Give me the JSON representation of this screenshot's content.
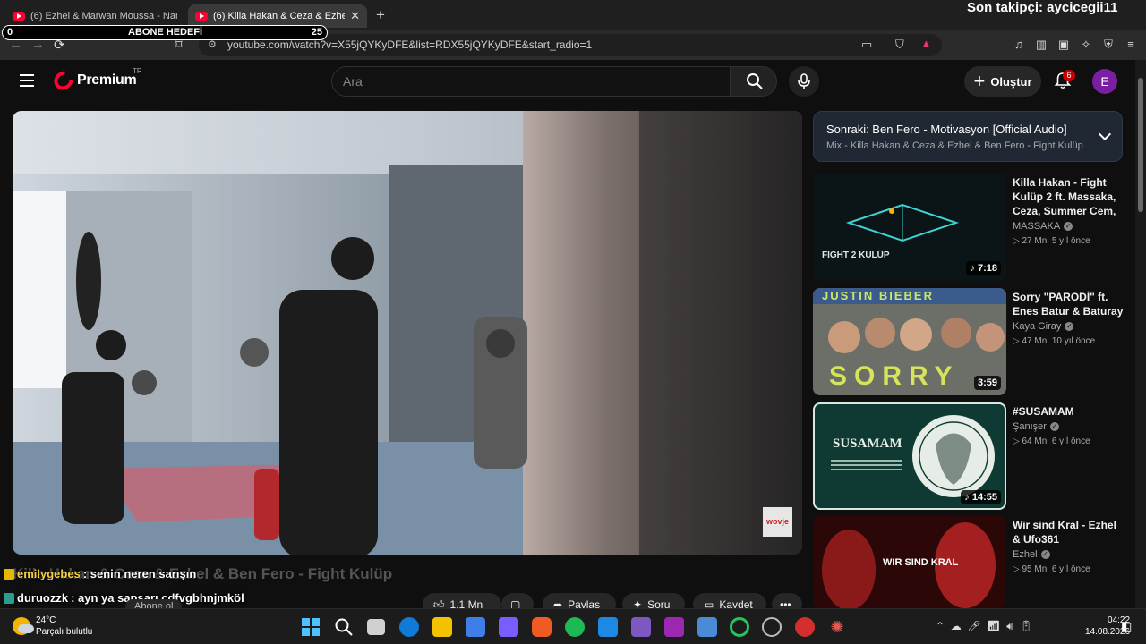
{
  "browser": {
    "tabs": [
      {
        "title": "(6) Ezhel & Marwan Moussa - Nane ¿",
        "active": false
      },
      {
        "title": "(6) Killa Hakan & Ceza & Ezhel &",
        "active": true
      }
    ],
    "new_tab": "+",
    "url": "youtube.com/watch?v=X55jQYKyDFE&list=RDX55jQYKyDFE&start_radio=1"
  },
  "stream_overlay": {
    "follower": "Son takipçi: aycicegii11",
    "goal_label": "ABONE HEDEFİ",
    "goal_start": "0",
    "goal_target": "25",
    "chat": [
      {
        "user": "emilygebes",
        "message": ": senin neren sarışın"
      },
      {
        "user": "duruozzk",
        "message": ": ayn ya sapsarı cdfvgbhnjmköl"
      }
    ]
  },
  "youtube": {
    "logo": "Premium",
    "region": "TR",
    "search_placeholder": "Ara",
    "create_label": "Oluştur",
    "notification_count": "6",
    "avatar_initial": "E",
    "video_title": "Killa Hakan & Ceza & Ezhel & Ben Fero - Fight Kulüp",
    "watermark": "wovje",
    "subscribe_label": "Abone ol",
    "actions": {
      "likes": "1,1 Mn",
      "share": "Paylaş",
      "ask": "Soru",
      "save": "Kaydet"
    },
    "up_next": {
      "title": "Sonraki: Ben Fero - Motivasyon [Official Audio]",
      "subtitle": "Mix - Killa Hakan & Ceza & Ezhel & Ben Fero - Fight Kulüp"
    },
    "recommendations": [
      {
        "title": "Killa Hakan - Fight Kulüp 2 ft. Massaka, Ceza, Summer Cem, ...",
        "channel": "MASSAKA",
        "views": "27 Mn",
        "age": "5 yıl önce",
        "duration": "7:18",
        "thumb_text": "FIGHT 2 KULÜP"
      },
      {
        "title": "Sorry \"PARODİ\" ft. Enes Batur & Baturay",
        "channel": "Kaya Giray",
        "views": "47 Mn",
        "age": "10 yıl önce",
        "duration": "3:59",
        "thumb_text": "SORRY",
        "thumb_text2": "JUSTIN BIEBER"
      },
      {
        "title": "#SUSAMAM",
        "channel": "Şanışer",
        "views": "64 Mn",
        "age": "6 yıl önce",
        "duration": "14:55",
        "thumb_text": "SUSAMAM"
      },
      {
        "title": "Wir sind Kral - Ezhel & Ufo361",
        "channel": "Ezhel",
        "views": "95 Mn",
        "age": "6 yıl önce",
        "duration": "",
        "thumb_text": "WIR SIND KRAL"
      }
    ]
  },
  "taskbar": {
    "temperature": "24°C",
    "weather": "Parçalı bulutlu",
    "time": "04:22",
    "date": "14.08.2026"
  },
  "colors": {
    "yt_red": "#ff0033",
    "background": "#0f0f0f",
    "up_next_bg": "#1f2833"
  }
}
